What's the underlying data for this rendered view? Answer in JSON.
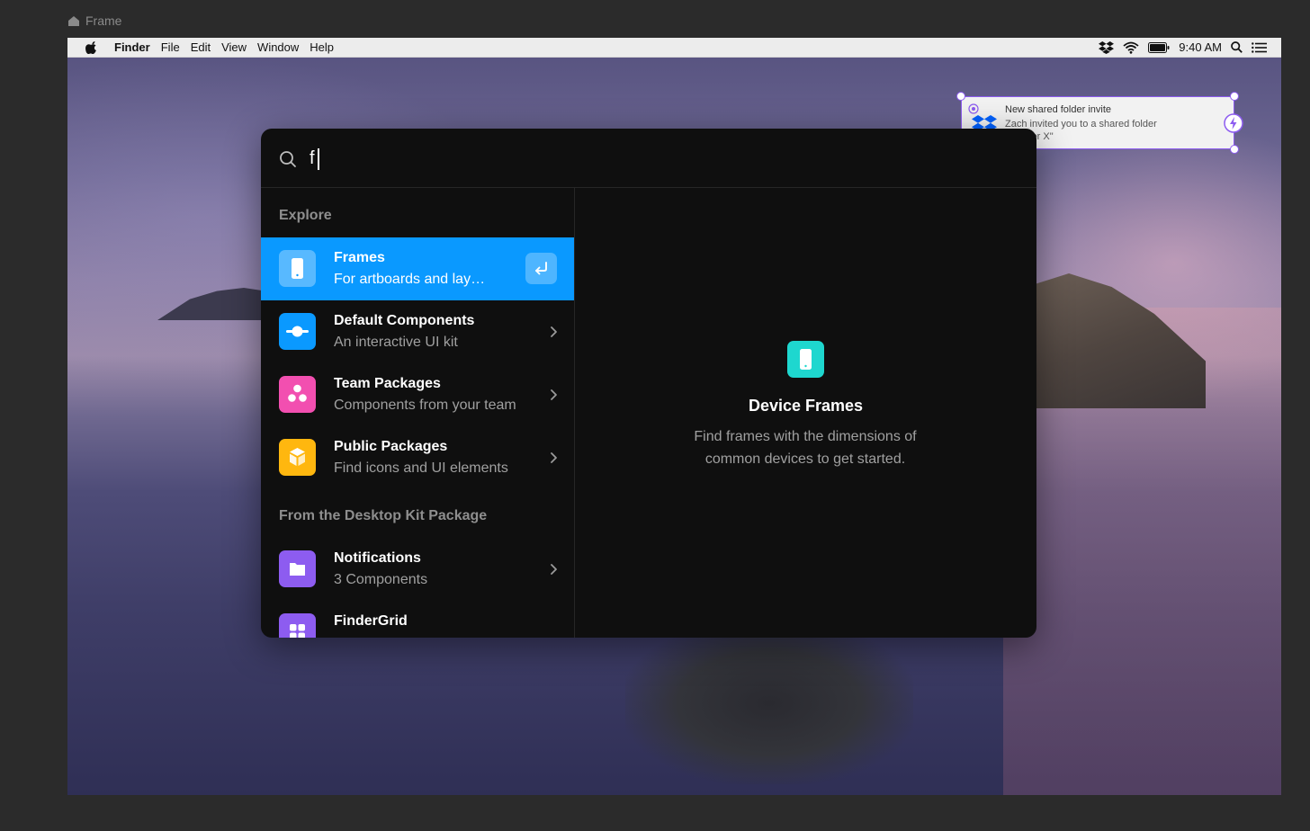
{
  "canvas": {
    "frame_label": "Frame"
  },
  "menubar": {
    "app_name": "Finder",
    "menus": [
      "File",
      "Edit",
      "View",
      "Window",
      "Help"
    ],
    "clock": "9:40 AM"
  },
  "notification": {
    "title": "New shared folder invite",
    "body": "Zach invited you to a shared folder \"Framer X\""
  },
  "palette": {
    "search": {
      "value": "f",
      "placeholder": ""
    },
    "sections": {
      "explore": "Explore",
      "desktop_kit": "From the Desktop Kit Package"
    },
    "items": [
      {
        "title": "Frames",
        "subtitle": "For artboards and lay…",
        "color": "#0a99ff",
        "icon": "phone-icon"
      },
      {
        "title": "Default Components",
        "subtitle": "An interactive UI kit",
        "color": "#0a99ff",
        "icon": "toggle-icon"
      },
      {
        "title": "Team Packages",
        "subtitle": "Components from your team",
        "color": "#f24fb0",
        "icon": "team-icon"
      },
      {
        "title": "Public Packages",
        "subtitle": "Find icons and UI elements",
        "color": "#ffb70f",
        "icon": "package-box-icon"
      },
      {
        "title": "Notifications",
        "subtitle": "3 Components",
        "color": "#8d5cf0",
        "icon": "folder-icon"
      },
      {
        "title": "FinderGrid",
        "subtitle": "",
        "color": "#8d5cf0",
        "icon": "grid-icon"
      }
    ],
    "detail": {
      "title": "Device Frames",
      "description": "Find frames with the dimensions of common devices to get started.",
      "color": "#1ed7cf",
      "icon": "phone-icon"
    }
  }
}
